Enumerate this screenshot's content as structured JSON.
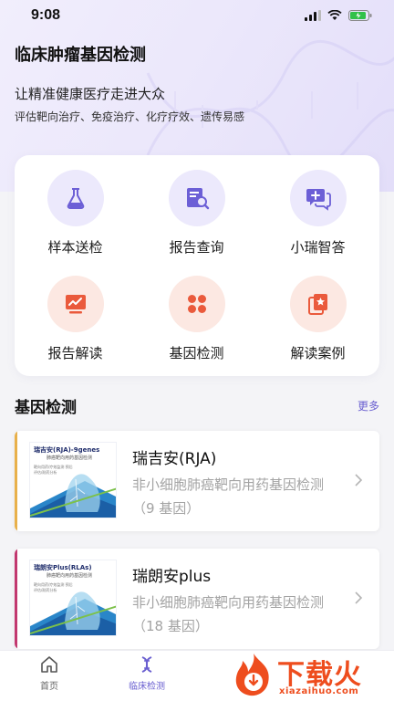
{
  "status_bar": {
    "time": "9:08"
  },
  "header": {
    "title": "临床肿瘤基因检测",
    "slogan": "让精准健康医疗走进大众",
    "subslogan": "评估靶向治疗、免疫治疗、化疗疗效、遗传易感"
  },
  "menu": {
    "items": [
      {
        "label": "样本送检",
        "icon": "flask-icon"
      },
      {
        "label": "报告查询",
        "icon": "report-search-icon"
      },
      {
        "label": "小瑞智答",
        "icon": "chat-plus-icon"
      },
      {
        "label": "报告解读",
        "icon": "trend-chart-icon"
      },
      {
        "label": "基因检测",
        "icon": "four-petal-icon"
      },
      {
        "label": "解读案例",
        "icon": "case-cards-icon"
      }
    ]
  },
  "section": {
    "title": "基因检测",
    "more": "更多"
  },
  "products": [
    {
      "name": "瑞吉安(RJA)",
      "desc_line1": "非小细胞肺癌靶向用药基因检测",
      "desc_line2": "（9 基因）",
      "thumb_title": "瑞吉安(RJA)-9genes",
      "thumb_subtitle": "肺癌靶向用药基因检测",
      "thumb_note": "靶向用药/疗效监测 预后评估/耐药分析",
      "accent": "#e8b04a"
    },
    {
      "name": "瑞朗安plus",
      "desc_line1": "非小细胞肺癌靶向用药基因检测",
      "desc_line2": "（18 基因）",
      "thumb_title": "瑞朗安Plus(RLAs)",
      "thumb_subtitle": "肺癌靶向用药基因检测",
      "thumb_note": "靶向用药/疗效监测 预后评估/耐药分析",
      "accent": "#c2386f"
    }
  ],
  "tab_bar": {
    "tabs": [
      {
        "label": "首页",
        "active": false
      },
      {
        "label": "临床检测",
        "active": true
      }
    ]
  },
  "watermark": {
    "text": "下载火",
    "domain": "xiazaihuo.com"
  },
  "colors": {
    "accent": "#6a5fd0",
    "icon_purple": "#6c5fd6",
    "icon_peach": "#ea5a3c",
    "watermark": "#ee4d1e"
  }
}
